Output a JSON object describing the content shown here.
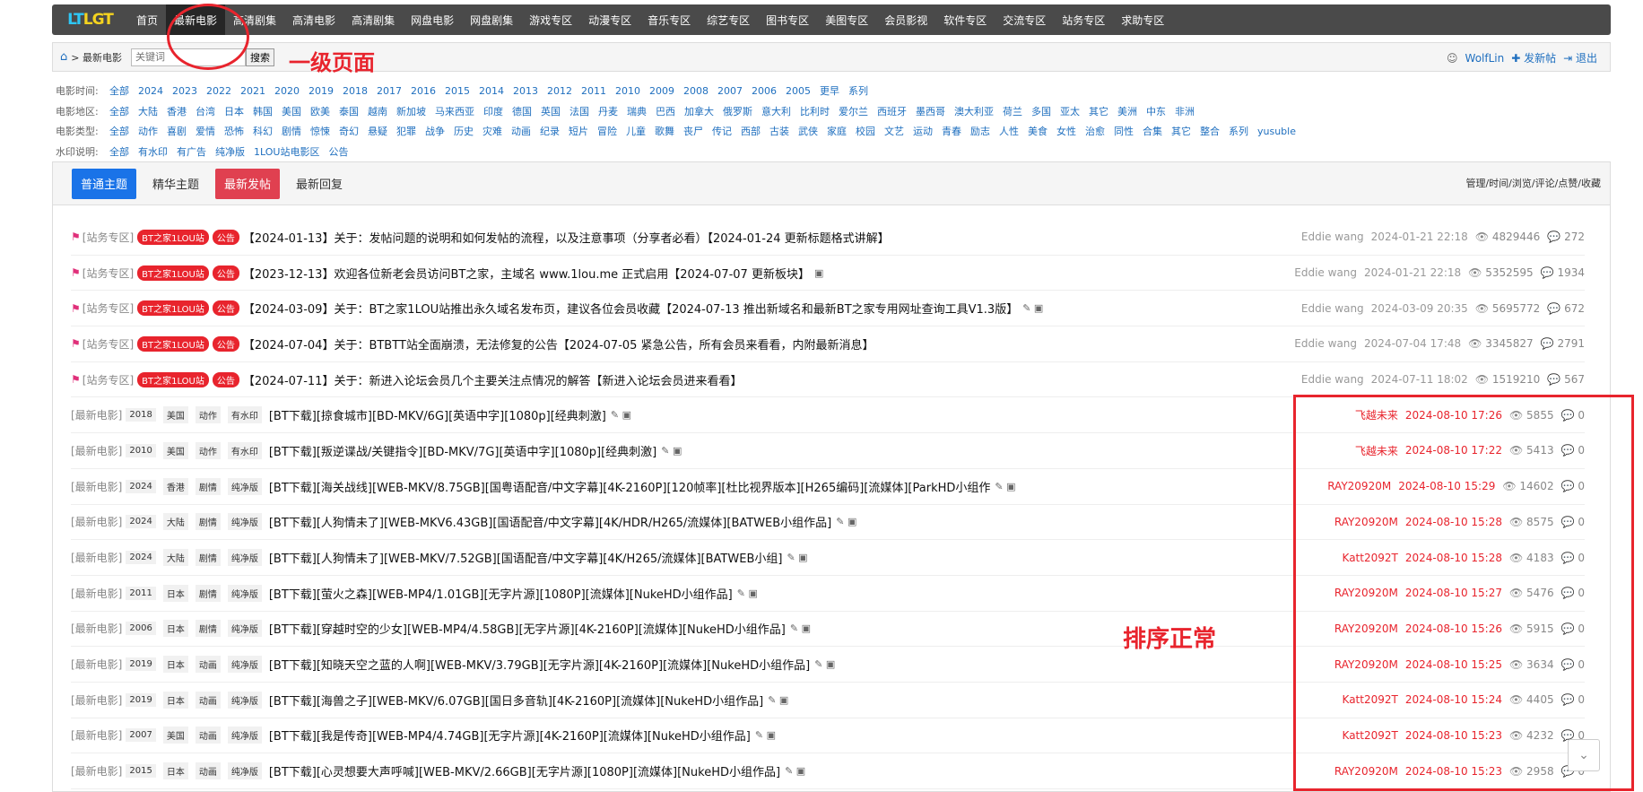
{
  "logo": {
    "left": "LT",
    "right": "LGT"
  },
  "nav": [
    "首页",
    "最新电影",
    "高清剧集",
    "高清电影",
    "高清剧集",
    "网盘电影",
    "网盘剧集",
    "游戏专区",
    "动漫专区",
    "音乐专区",
    "综艺专区",
    "图书专区",
    "美图专区",
    "会员影视",
    "软件专区",
    "交流专区",
    "站务专区",
    "求助专区"
  ],
  "breadcrumb": {
    "current": "最新电影",
    "sep": ">"
  },
  "search": {
    "placeholder": "关键词",
    "button": "搜索"
  },
  "user": {
    "name": "WolfLin",
    "post": "发新帖",
    "logout": "退出"
  },
  "annotations": {
    "first_level": "一级页面",
    "sort_ok": "排序正常"
  },
  "filters": [
    {
      "label": "电影时间:",
      "options": [
        "全部",
        "2024",
        "2023",
        "2022",
        "2021",
        "2020",
        "2019",
        "2018",
        "2017",
        "2016",
        "2015",
        "2014",
        "2013",
        "2012",
        "2011",
        "2010",
        "2009",
        "2008",
        "2007",
        "2006",
        "2005",
        "更早",
        "系列"
      ]
    },
    {
      "label": "电影地区:",
      "options": [
        "全部",
        "大陆",
        "香港",
        "台湾",
        "日本",
        "韩国",
        "美国",
        "欧美",
        "泰国",
        "越南",
        "新加坡",
        "马来西亚",
        "印度",
        "德国",
        "英国",
        "法国",
        "丹麦",
        "瑞典",
        "巴西",
        "加拿大",
        "俄罗斯",
        "意大利",
        "比利时",
        "爱尔兰",
        "西班牙",
        "墨西哥",
        "澳大利亚",
        "荷兰",
        "多国",
        "亚太",
        "其它",
        "美洲",
        "中东",
        "非洲"
      ]
    },
    {
      "label": "电影类型:",
      "options": [
        "全部",
        "动作",
        "喜剧",
        "爱情",
        "恐怖",
        "科幻",
        "剧情",
        "惊悚",
        "奇幻",
        "悬疑",
        "犯罪",
        "战争",
        "历史",
        "灾难",
        "动画",
        "纪录",
        "短片",
        "冒险",
        "儿童",
        "歌舞",
        "丧尸",
        "传记",
        "西部",
        "古装",
        "武侠",
        "家庭",
        "校园",
        "文艺",
        "运动",
        "青春",
        "励志",
        "人性",
        "美食",
        "女性",
        "治愈",
        "同性",
        "合集",
        "其它",
        "整合",
        "系列",
        "yusuble"
      ]
    },
    {
      "label": "水印说明:",
      "options": [
        "全部",
        "有水印",
        "有广告",
        "纯净版",
        "1LOU站电影区",
        "公告"
      ]
    }
  ],
  "tabs": [
    "普通主题",
    "精华主题",
    "最新发帖",
    "最新回复"
  ],
  "sort_text": "管理/时间/浏览/评论/点赞/收藏",
  "pinned": [
    {
      "section": "[站务专区]",
      "badge1": "BT之家1LOU站",
      "badge2": "公告",
      "title": "【2024-01-13】关于：发帖问题的说明和如何发帖的流程，以及注意事项（分享者必看）【2024-01-24 更新标题格式讲解】",
      "icons": "",
      "author": "Eddie wang",
      "time": "2024-01-21 22:18",
      "views": "4829446",
      "replies": "272"
    },
    {
      "section": "[站务专区]",
      "badge1": "BT之家1LOU站",
      "badge2": "公告",
      "title": "【2023-12-13】欢迎各位新老会员访问BT之家，主域名 www.1lou.me 正式启用【2024-07-07 更新板块】",
      "icons": "▣",
      "author": "Eddie wang",
      "time": "2024-01-21 22:18",
      "views": "5352595",
      "replies": "1934"
    },
    {
      "section": "[站务专区]",
      "badge1": "BT之家1LOU站",
      "badge2": "公告",
      "title": "【2024-03-09】关于：BT之家1LOU站推出永久域名发布页，建议各位会员收藏【2024-07-13 推出新域名和最新BT之家专用网址查询工具V1.3版】",
      "icons": "✎ ▣",
      "author": "Eddie wang",
      "time": "2024-03-09 20:35",
      "views": "5695772",
      "replies": "672"
    },
    {
      "section": "[站务专区]",
      "badge1": "BT之家1LOU站",
      "badge2": "公告",
      "title": "【2024-07-04】关于：BTBTT站全面崩溃，无法修复的公告【2024-07-05 紧急公告，所有会员来看看，内附最新消息】",
      "icons": "",
      "author": "Eddie wang",
      "time": "2024-07-04 17:48",
      "views": "3345827",
      "replies": "2791"
    },
    {
      "section": "[站务专区]",
      "badge1": "BT之家1LOU站",
      "badge2": "公告",
      "title": "【2024-07-11】关于：新进入论坛会员几个主要关注点情况的解答【新进入论坛会员进来看看】",
      "icons": "",
      "author": "Eddie wang",
      "time": "2024-07-11 18:02",
      "views": "1519210",
      "replies": "567"
    }
  ],
  "threads": [
    {
      "section": "[最新电影]",
      "year": "2018",
      "region": "美国",
      "genre": "动作",
      "wm": "有水印",
      "title": "[BT下载][掠食城市][BD-MKV/6G][英语中字][1080p][经典刺激]",
      "icons": "✎ ▣",
      "author": "飞越未来",
      "time": "2024-08-10 17:26",
      "views": "5855",
      "replies": "0"
    },
    {
      "section": "[最新电影]",
      "year": "2010",
      "region": "美国",
      "genre": "动作",
      "wm": "有水印",
      "title": "[BT下载][叛逆谍战/关键指令][BD-MKV/7G][英语中字][1080p][经典刺激]",
      "icons": "✎ ▣",
      "author": "飞越未来",
      "time": "2024-08-10 17:22",
      "views": "5413",
      "replies": "0"
    },
    {
      "section": "[最新电影]",
      "year": "2024",
      "region": "香港",
      "genre": "剧情",
      "wm": "纯净版",
      "title": "[BT下载][海关战线][WEB-MKV/8.75GB][国粤语配音/中文字幕][4K-2160P][120帧率][杜比视界版本][H265编码][流媒体][ParkHD小组作",
      "icons": "✎ ▣",
      "author": "RAY20920M",
      "time": "2024-08-10 15:29",
      "views": "14602",
      "replies": "0"
    },
    {
      "section": "[最新电影]",
      "year": "2024",
      "region": "大陆",
      "genre": "剧情",
      "wm": "纯净版",
      "title": "[BT下载][人狗情未了][WEB-MKV6.43GB][国语配音/中文字幕][4K/HDR/H265/流媒体][BATWEB小组作品]",
      "icons": "✎ ▣",
      "author": "RAY20920M",
      "time": "2024-08-10 15:28",
      "views": "8575",
      "replies": "0"
    },
    {
      "section": "[最新电影]",
      "year": "2024",
      "region": "大陆",
      "genre": "剧情",
      "wm": "纯净版",
      "title": "[BT下载][人狗情未了][WEB-MKV/7.52GB][国语配音/中文字幕][4K/H265/流媒体][BATWEB小组]",
      "icons": "✎ ▣",
      "author": "Katt2092T",
      "time": "2024-08-10 15:28",
      "views": "4183",
      "replies": "0"
    },
    {
      "section": "[最新电影]",
      "year": "2011",
      "region": "日本",
      "genre": "剧情",
      "wm": "纯净版",
      "title": "[BT下载][萤火之森][WEB-MP4/1.01GB][无字片源][1080P][流媒体][NukeHD小组作品]",
      "icons": "✎ ▣",
      "author": "RAY20920M",
      "time": "2024-08-10 15:27",
      "views": "5476",
      "replies": "0"
    },
    {
      "section": "[最新电影]",
      "year": "2006",
      "region": "日本",
      "genre": "剧情",
      "wm": "纯净版",
      "title": "[BT下载][穿越时空的少女][WEB-MP4/4.58GB][无字片源][4K-2160P][流媒体][NukeHD小组作品]",
      "icons": "✎ ▣",
      "author": "RAY20920M",
      "time": "2024-08-10 15:26",
      "views": "5915",
      "replies": "0"
    },
    {
      "section": "[最新电影]",
      "year": "2019",
      "region": "日本",
      "genre": "动画",
      "wm": "纯净版",
      "title": "[BT下载][知晓天空之蓝的人啊][WEB-MKV/3.79GB][无字片源][4K-2160P][流媒体][NukeHD小组作品]",
      "icons": "✎ ▣",
      "author": "RAY20920M",
      "time": "2024-08-10 15:25",
      "views": "3634",
      "replies": "0"
    },
    {
      "section": "[最新电影]",
      "year": "2019",
      "region": "日本",
      "genre": "动画",
      "wm": "纯净版",
      "title": "[BT下载][海兽之子][WEB-MKV/6.07GB][国日多音轨][4K-2160P][流媒体][NukeHD小组作品]",
      "icons": "✎ ▣",
      "author": "Katt2092T",
      "time": "2024-08-10 15:24",
      "views": "4405",
      "replies": "0"
    },
    {
      "section": "[最新电影]",
      "year": "2007",
      "region": "美国",
      "genre": "动画",
      "wm": "纯净版",
      "title": "[BT下载][我是传奇][WEB-MP4/4.74GB][无字片源][4K-2160P][流媒体][NukeHD小组作品]",
      "icons": "✎ ▣",
      "author": "Katt2092T",
      "time": "2024-08-10 15:23",
      "views": "4232",
      "replies": "0"
    },
    {
      "section": "[最新电影]",
      "year": "2015",
      "region": "日本",
      "genre": "动画",
      "wm": "纯净版",
      "title": "[BT下载][心灵想要大声呼喊][WEB-MKV/2.66GB][无字片源][1080P][流媒体][NukeHD小组作品]",
      "icons": "✎ ▣",
      "author": "RAY20920M",
      "time": "2024-08-10 15:23",
      "views": "2958",
      "replies": "0"
    }
  ]
}
